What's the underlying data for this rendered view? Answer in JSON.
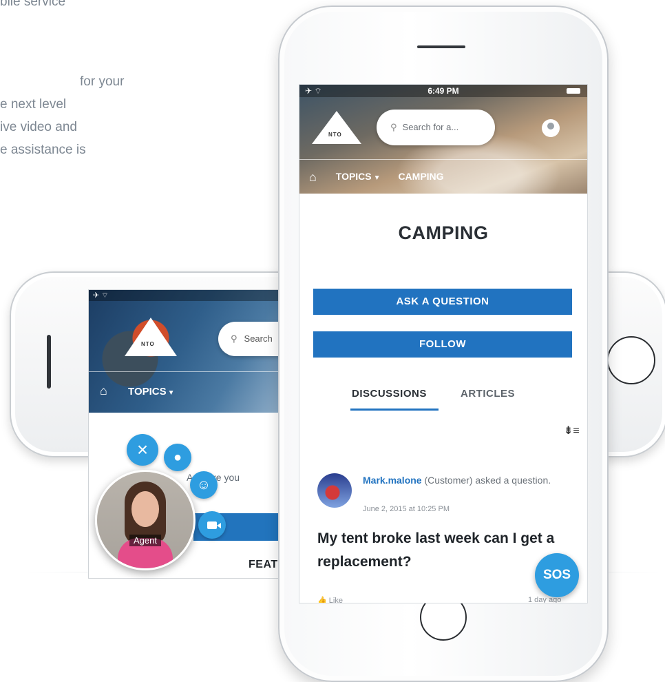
{
  "marketing": {
    "heading_tail": "bile service",
    "lines": [
      " for your",
      "e next level",
      "ive video and",
      "e assistance is"
    ]
  },
  "landscape": {
    "logo": "NTO",
    "search_placeholder": "Search",
    "nav_topics": "TOPICS",
    "snippet": "A      where you",
    "featured": "FEAT",
    "agent_label": "Agent",
    "widget": {
      "close_icon": "close-icon",
      "mic_icon": "microphone-icon",
      "chat_icon": "chat-icon",
      "video_icon": "video-camera-icon"
    }
  },
  "portrait": {
    "status_time": "6:49 PM",
    "logo": "NTO",
    "search_placeholder": "Search for a...",
    "nav": {
      "topics": "TOPICS",
      "current": "CAMPING"
    },
    "page_title": "CAMPING",
    "buttons": {
      "ask": "ASK A QUESTION",
      "follow": "FOLLOW"
    },
    "tabs": [
      {
        "label": "DISCUSSIONS",
        "active": true
      },
      {
        "label": "ARTICLES",
        "active": false
      }
    ],
    "post": {
      "author": "Mark.malone",
      "meta": " (Customer) asked a question.",
      "date": "June 2, 2015 at 10:25 PM",
      "title": "My tent broke last week can I get a replacement?",
      "like": "Like",
      "ago": "1 day ago"
    },
    "sos": "SOS"
  },
  "colors": {
    "primary": "#2173c0",
    "fab": "#2e9de0"
  }
}
